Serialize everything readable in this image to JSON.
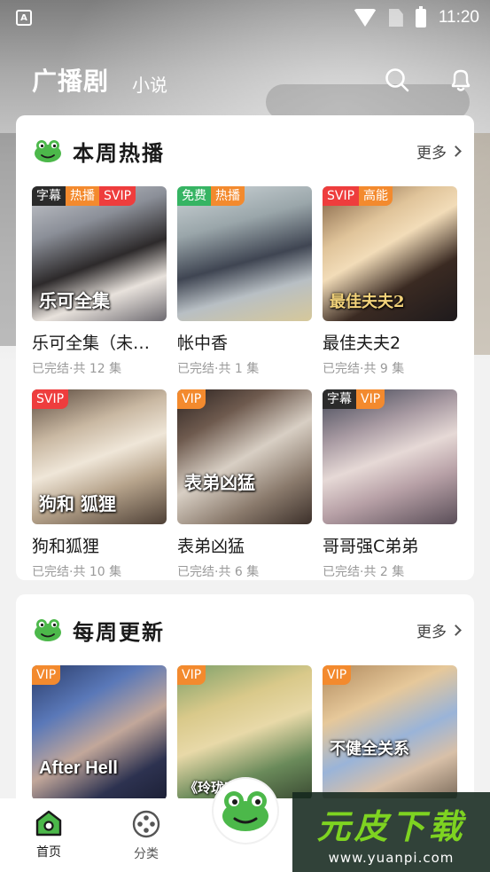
{
  "status": {
    "time": "11:20",
    "app_icon": "A"
  },
  "topnav": {
    "tab_main": "广播剧",
    "tab_sub": "小说",
    "icons": [
      "search-icon",
      "bell-icon"
    ]
  },
  "section1": {
    "title": "本周热播",
    "more": "更多",
    "items": [
      {
        "name": "乐可全集（未…",
        "meta": "已完结·共 12 集",
        "cover_text": "乐可全集",
        "tags": [
          "字幕",
          "热播",
          "SVIP"
        ]
      },
      {
        "name": "帐中香",
        "meta": "已完结·共 1 集",
        "cover_text": "",
        "tags": [
          "免费",
          "热播"
        ]
      },
      {
        "name": "最佳夫夫2",
        "meta": "已完结·共 9 集",
        "cover_text": "最佳夫夫2",
        "tags": [
          "SVIP",
          "高能"
        ]
      },
      {
        "name": "狗和狐狸",
        "meta": "已完结·共 10 集",
        "cover_text": "狗和 狐狸",
        "tags": [
          "SVIP"
        ]
      },
      {
        "name": "表弟凶猛",
        "meta": "已完结·共 6 集",
        "cover_text": "表弟凶猛",
        "tags": [
          "VIP"
        ]
      },
      {
        "name": "哥哥强C弟弟",
        "meta": "已完结·共 2 集",
        "cover_text": "",
        "tags": [
          "字幕",
          "VIP"
        ]
      }
    ]
  },
  "section2": {
    "title": "每周更新",
    "more": "更多",
    "items": [
      {
        "cover_text": "After Hell",
        "tags": [
          "VIP"
        ]
      },
      {
        "cover_text": "《玲珑字》",
        "tags": [
          "VIP"
        ]
      },
      {
        "cover_text": "不健全关系",
        "tags": [
          "VIP"
        ]
      }
    ]
  },
  "bottomnav": {
    "home": "首页",
    "category": "分类"
  },
  "watermark": {
    "title": "元皮下载",
    "url": "www.yuanpi.com"
  },
  "colors": {
    "accent_orange": "#f38a2e",
    "svip_red": "#ee3d3d",
    "free_green": "#36b463",
    "frog_green": "#4cb84a"
  }
}
